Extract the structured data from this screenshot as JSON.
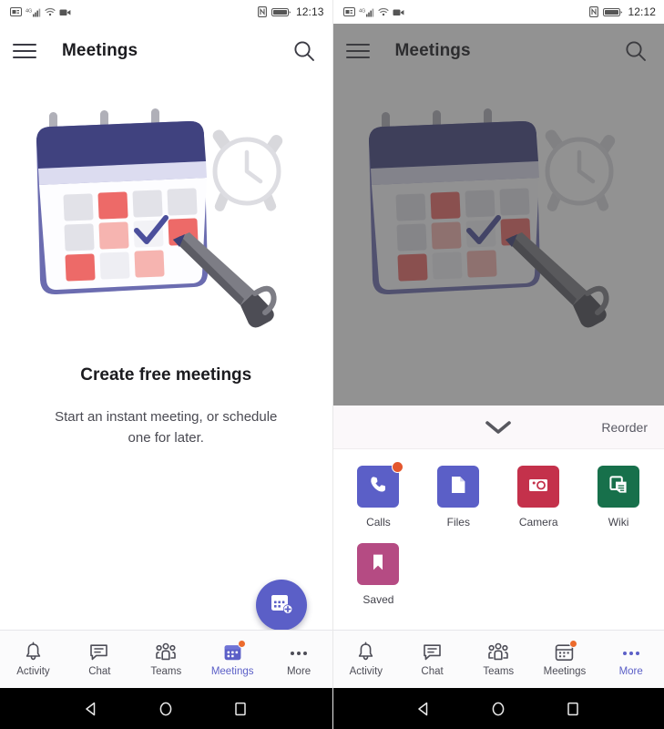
{
  "colors": {
    "brand_purple": "#5b5fc7",
    "badge_orange": "#e4572e",
    "camera_red": "#c4314b",
    "wiki_green": "#17704b",
    "saved_magenta": "#b54b83",
    "nav_inactive": "#4d4d57",
    "dim_overlay": "#3c3c3c"
  },
  "left_phone": {
    "statusbar": {
      "time": "12:13",
      "left_icons": [
        "sim-card-icon",
        "signal-4g-icon",
        "wifi-icon",
        "video-recording-icon"
      ],
      "right_icons": [
        "nfc-icon",
        "battery-icon"
      ]
    },
    "appbar": {
      "menu_icon": "hamburger-menu-icon",
      "title": "Meetings",
      "search_icon": "search-icon"
    },
    "illustration": {
      "name": "calendar-with-pen-and-alarm-clock-illustration"
    },
    "empty_state": {
      "title": "Create free meetings",
      "subtitle": "Start an instant meeting, or schedule one for later."
    },
    "fab": {
      "icon": "calendar-add-icon",
      "label": "New meeting"
    },
    "bottom_nav": {
      "items": [
        {
          "label": "Activity",
          "icon": "bell-icon",
          "active": false,
          "badge": false
        },
        {
          "label": "Chat",
          "icon": "chat-bubble-icon",
          "active": false,
          "badge": false
        },
        {
          "label": "Teams",
          "icon": "people-icon",
          "active": false,
          "badge": false
        },
        {
          "label": "Meetings",
          "icon": "calendar-icon",
          "active": true,
          "badge": true
        },
        {
          "label": "More",
          "icon": "ellipsis-icon",
          "active": false,
          "badge": false
        }
      ]
    },
    "system_bar": {
      "buttons": [
        "back-button",
        "home-button",
        "recents-button"
      ]
    }
  },
  "right_phone": {
    "statusbar": {
      "time": "12:12",
      "left_icons": [
        "sim-card-icon",
        "signal-4g-icon",
        "wifi-icon",
        "video-recording-icon"
      ],
      "right_icons": [
        "nfc-icon",
        "battery-icon"
      ]
    },
    "appbar": {
      "menu_icon": "hamburger-menu-icon",
      "title": "Meetings",
      "search_icon": "search-icon"
    },
    "sheet": {
      "collapse_icon": "chevron-down-icon",
      "reorder_label": "Reorder",
      "apps": [
        {
          "label": "Calls",
          "icon": "phone-icon",
          "color": "#5b5fc7",
          "badge": true
        },
        {
          "label": "Files",
          "icon": "file-icon",
          "color": "#5b5fc7",
          "badge": false
        },
        {
          "label": "Camera",
          "icon": "camera-icon",
          "color": "#c4314b",
          "badge": false
        },
        {
          "label": "Wiki",
          "icon": "wiki-pages-icon",
          "color": "#17704b",
          "badge": false
        },
        {
          "label": "Saved",
          "icon": "bookmark-icon",
          "color": "#b54b83",
          "badge": false
        }
      ]
    },
    "bottom_nav": {
      "items": [
        {
          "label": "Activity",
          "icon": "bell-icon",
          "active": false,
          "badge": false
        },
        {
          "label": "Chat",
          "icon": "chat-bubble-icon",
          "active": false,
          "badge": false
        },
        {
          "label": "Teams",
          "icon": "people-icon",
          "active": false,
          "badge": false
        },
        {
          "label": "Meetings",
          "icon": "calendar-icon",
          "active": false,
          "badge": true
        },
        {
          "label": "More",
          "icon": "ellipsis-icon",
          "active": true,
          "badge": false
        }
      ]
    },
    "system_bar": {
      "buttons": [
        "back-button",
        "home-button",
        "recents-button"
      ]
    }
  }
}
